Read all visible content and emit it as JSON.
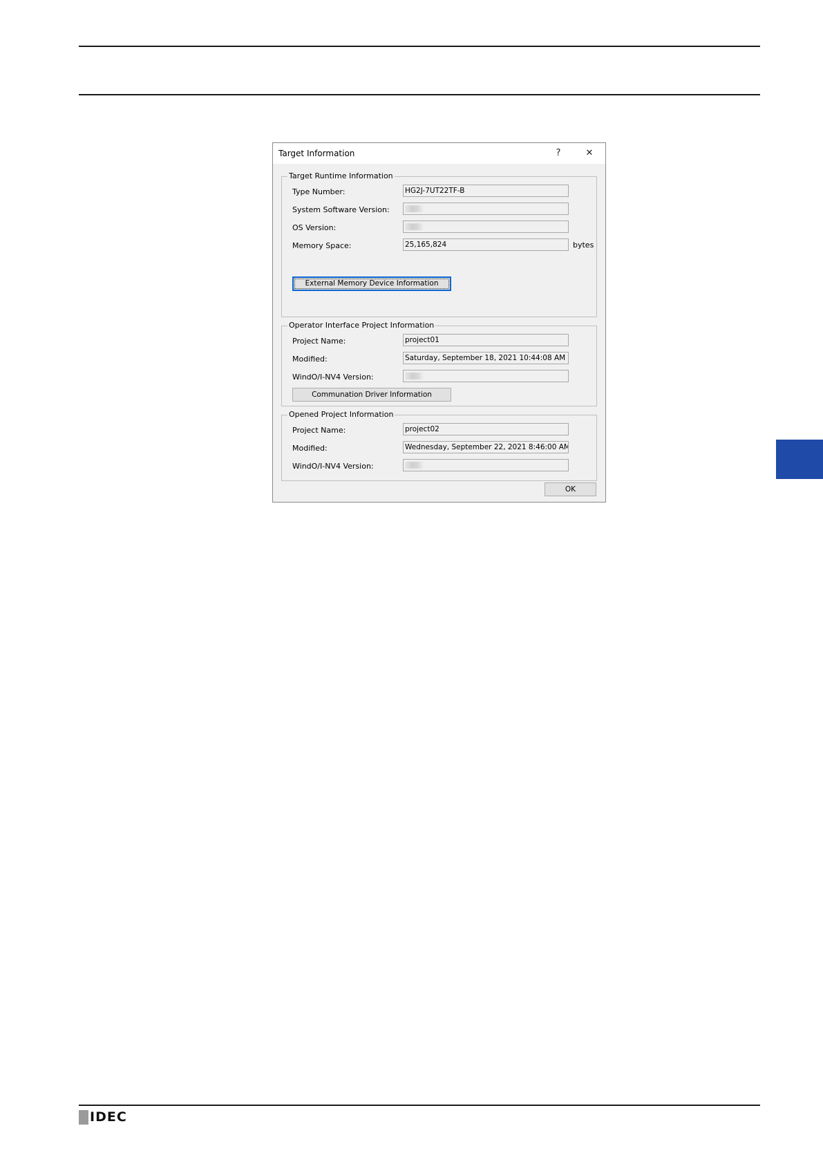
{
  "dialog": {
    "title": "Target Information",
    "help_glyph": "?",
    "close_glyph": "✕",
    "target_runtime": {
      "legend": "Target Runtime Information",
      "type_number_label": "Type Number:",
      "type_number_value": "HG2J-7UT22TF-B",
      "system_software_label": "System Software Version:",
      "os_version_label": "OS Version:",
      "memory_space_label": "Memory Space:",
      "memory_space_value": "25,165,824",
      "memory_unit": "bytes",
      "external_memory_button": "External Memory Device Information"
    },
    "operator_interface": {
      "legend": "Operator Interface Project Information",
      "project_name_label": "Project Name:",
      "project_name_value": "project01",
      "modified_label": "Modified:",
      "modified_value": "Saturday, September 18, 2021 10:44:08 AM",
      "version_label": "WindO/I-NV4 Version:",
      "comm_driver_button": "Communation Driver Information"
    },
    "opened_project": {
      "legend": "Opened Project Information",
      "project_name_label": "Project Name:",
      "project_name_value": "project02",
      "modified_label": "Modified:",
      "modified_value": "Wednesday, September 22, 2021 8:46:00 AM",
      "version_label": "WindO/I-NV4 Version:"
    },
    "ok_button": "OK"
  },
  "footer": {
    "logo_text": "IDEC"
  },
  "colors": {
    "side_tab": "#1f4aa8",
    "focus_border": "#0a64d0"
  }
}
